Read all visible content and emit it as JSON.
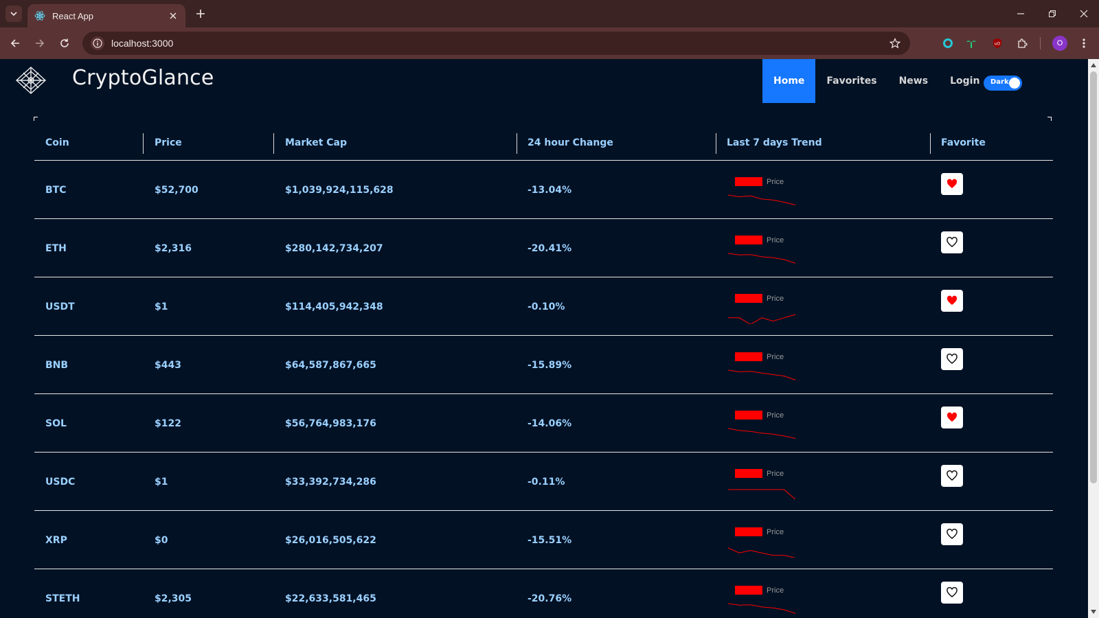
{
  "browser": {
    "tab_title": "React App",
    "url": "localhost:3000",
    "profile_initial": "O"
  },
  "app": {
    "brand": "CryptoGlance",
    "nav": [
      "Home",
      "Favorites",
      "News",
      "Login"
    ],
    "active_nav": "Home",
    "theme_toggle_label": "Dark",
    "accent_color": "#1677ff"
  },
  "table": {
    "headers": [
      "Coin",
      "Price",
      "Market Cap",
      "24 hour Change",
      "Last 7 days Trend",
      "Favorite"
    ],
    "trend_legend_label": "Price",
    "trend_color": "#ff0000",
    "rows": [
      {
        "coin": "BTC",
        "price": "$52,700",
        "market_cap": "$1,039,924,115,628",
        "change": "-13.04%",
        "favorite": true,
        "trend": [
          10,
          9.6,
          9.8,
          9.1,
          8.9,
          8.4,
          7.8
        ]
      },
      {
        "coin": "ETH",
        "price": "$2,316",
        "market_cap": "$280,142,734,207",
        "change": "-20.41%",
        "favorite": false,
        "trend": [
          10,
          9.5,
          9.6,
          8.9,
          8.6,
          8.0,
          6.8
        ]
      },
      {
        "coin": "USDT",
        "price": "$1",
        "market_cap": "$114,405,942,348",
        "change": "-0.10%",
        "favorite": true,
        "trend": [
          10,
          10,
          9.9,
          10,
          9.95,
          10,
          10.05
        ]
      },
      {
        "coin": "BNB",
        "price": "$443",
        "market_cap": "$64,587,867,665",
        "change": "-15.89%",
        "favorite": false,
        "trend": [
          10,
          9.3,
          9.5,
          8.8,
          8.2,
          7.6,
          6.0
        ]
      },
      {
        "coin": "SOL",
        "price": "$122",
        "market_cap": "$56,764,983,176",
        "change": "-14.06%",
        "favorite": true,
        "trend": [
          10,
          9.4,
          9.1,
          8.6,
          8.3,
          7.7,
          7.0
        ]
      },
      {
        "coin": "USDC",
        "price": "$1",
        "market_cap": "$33,392,734,286",
        "change": "-0.11%",
        "favorite": false,
        "trend": [
          10,
          10,
          10,
          10,
          10,
          10,
          9.9
        ]
      },
      {
        "coin": "XRP",
        "price": "$0",
        "market_cap": "$26,016,505,622",
        "change": "-15.51%",
        "favorite": false,
        "trend": [
          10,
          9.8,
          9.9,
          9.8,
          9.7,
          9.7,
          9.6
        ]
      },
      {
        "coin": "STETH",
        "price": "$2,305",
        "market_cap": "$22,633,581,465",
        "change": "-20.76%",
        "favorite": false,
        "trend": [
          10,
          9.5,
          9.6,
          8.9,
          8.6,
          8.0,
          6.8
        ]
      }
    ]
  }
}
